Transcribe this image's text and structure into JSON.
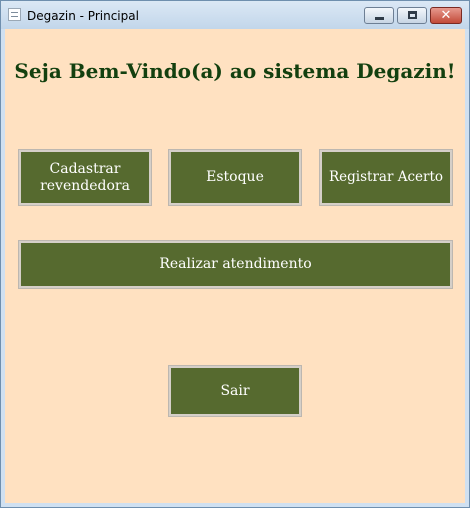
{
  "window": {
    "title": "Degazin - Principal",
    "controls": {
      "minimize": "minimize",
      "maximize": "maximize",
      "close": "✕"
    }
  },
  "main": {
    "heading": "Seja Bem-Vindo(a) ao sistema Degazin!",
    "buttons": {
      "cadastrar_line1": "Cadastrar",
      "cadastrar_line2": "revendedora",
      "estoque": "Estoque",
      "registrar_acerto": "Registrar Acerto",
      "realizar_atendimento": "Realizar atendimento",
      "sair": "Sair"
    }
  },
  "colors": {
    "background": "#ffe1c1",
    "button": "#566a2f",
    "button_text": "#ffffff",
    "heading": "#13400f"
  }
}
